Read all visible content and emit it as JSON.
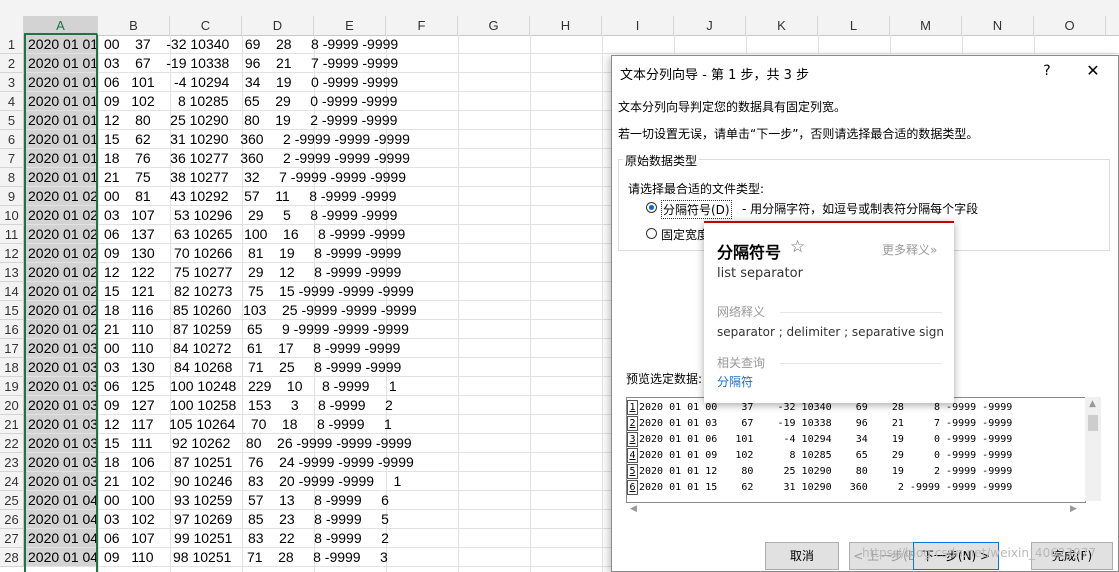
{
  "columns": [
    "A",
    "B",
    "C",
    "D",
    "E",
    "F",
    "G",
    "H",
    "I",
    "J",
    "K",
    "L",
    "M",
    "N",
    "O"
  ],
  "selected_column": "A",
  "rows": [
    {
      "n": "1",
      "a": "2020 01 01",
      "rest": "00    37    -32 10340    69    28     8 -9999 -9999"
    },
    {
      "n": "2",
      "a": "2020 01 01",
      "rest": "03    67    -19 10338    96    21     7 -9999 -9999"
    },
    {
      "n": "3",
      "a": "2020 01 01",
      "rest": "06   101     -4 10294    34    19     0 -9999 -9999"
    },
    {
      "n": "4",
      "a": "2020 01 01",
      "rest": "09   102      8 10285    65    29     0 -9999 -9999"
    },
    {
      "n": "5",
      "a": "2020 01 01",
      "rest": "12    80     25 10290    80    19     2 -9999 -9999"
    },
    {
      "n": "6",
      "a": "2020 01 01",
      "rest": "15    62     31 10290   360     2 -9999 -9999 -9999"
    },
    {
      "n": "7",
      "a": "2020 01 01",
      "rest": "18    76     36 10277   360     2 -9999 -9999 -9999"
    },
    {
      "n": "8",
      "a": "2020 01 01",
      "rest": "21    75     38 10277    32     7 -9999 -9999 -9999"
    },
    {
      "n": "9",
      "a": "2020 01 02",
      "rest": "00    81     43 10292    57    11     8 -9999 -9999"
    },
    {
      "n": "10",
      "a": "2020 01 02",
      "rest": "03   107     53 10296    29     5     8 -9999 -9999"
    },
    {
      "n": "11",
      "a": "2020 01 02",
      "rest": "06   137     63 10265   100    16     8 -9999 -9999"
    },
    {
      "n": "12",
      "a": "2020 01 02",
      "rest": "09   130     70 10266    81    19     8 -9999 -9999"
    },
    {
      "n": "13",
      "a": "2020 01 02",
      "rest": "12   122     75 10277    29    12     8 -9999 -9999"
    },
    {
      "n": "14",
      "a": "2020 01 02",
      "rest": "15   121     82 10273    75    15 -9999 -9999 -9999"
    },
    {
      "n": "15",
      "a": "2020 01 02",
      "rest": "18   116     85 10260   103    25 -9999 -9999 -9999"
    },
    {
      "n": "16",
      "a": "2020 01 02",
      "rest": "21   110     87 10259    65     9 -9999 -9999 -9999"
    },
    {
      "n": "17",
      "a": "2020 01 03",
      "rest": "00   110     84 10272    61    17     8 -9999 -9999"
    },
    {
      "n": "18",
      "a": "2020 01 03",
      "rest": "03   130     84 10268    71    25     8 -9999 -9999"
    },
    {
      "n": "19",
      "a": "2020 01 03",
      "rest": "06   125    100 10248   229    10     8 -9999     1"
    },
    {
      "n": "20",
      "a": "2020 01 03",
      "rest": "09   127    100 10258   153     3     8 -9999     2"
    },
    {
      "n": "21",
      "a": "2020 01 03",
      "rest": "12   117    105 10264    70    18     8 -9999     1"
    },
    {
      "n": "22",
      "a": "2020 01 03",
      "rest": "15   111     92 10262    80    26 -9999 -9999 -9999"
    },
    {
      "n": "23",
      "a": "2020 01 03",
      "rest": "18   106     87 10251    76    24 -9999 -9999 -9999"
    },
    {
      "n": "24",
      "a": "2020 01 03",
      "rest": "21   102     90 10246    83    20 -9999 -9999     1"
    },
    {
      "n": "25",
      "a": "2020 01 04",
      "rest": "00   100     93 10259    57    13     8 -9999     6"
    },
    {
      "n": "26",
      "a": "2020 01 04",
      "rest": "03   102     97 10269    85    23     8 -9999     5"
    },
    {
      "n": "27",
      "a": "2020 01 04",
      "rest": "06   107     99 10251    83    22     8 -9999     2"
    },
    {
      "n": "28",
      "a": "2020 01 04",
      "rest": "09   110     98 10251    71    28     8 -9999     3"
    }
  ],
  "dialog": {
    "title": "文本分列向导 - 第 1 步，共 3 步",
    "help": "?",
    "close": "✕",
    "desc1": "文本分列向导判定您的数据具有固定列宽。",
    "desc2": "若一切设置无误，请单击“下一步”，否则请选择最合适的数据类型。",
    "group_label": "原始数据类型",
    "prompt": "请选择最合适的文件类型:",
    "option1_label": "分隔符号(D)",
    "option1_desc": "- 用分隔字符，如逗号或制表符分隔每个字段",
    "option2_label": "固定宽度",
    "preview_label": "预览选定数据:",
    "preview_rows": [
      {
        "n": "1",
        "line": "2020 01 01 00    37    -32 10340    69    28     8 -9999 -9999"
      },
      {
        "n": "2",
        "line": "2020 01 01 03    67    -19 10338    96    21     7 -9999 -9999"
      },
      {
        "n": "3",
        "line": "2020 01 01 06   101     -4 10294    34    19     0 -9999 -9999"
      },
      {
        "n": "4",
        "line": "2020 01 01 09   102      8 10285    65    29     0 -9999 -9999"
      },
      {
        "n": "5",
        "line": "2020 01 01 12    80     25 10290    80    19     2 -9999 -9999"
      },
      {
        "n": "6",
        "line": "2020 01 01 15    62     31 10290   360     2 -9999 -9999 -9999"
      }
    ],
    "buttons": {
      "cancel": "取消",
      "prev": "< 上一步(B)",
      "next": "下一步(N) >",
      "finish": "完成(F)"
    },
    "watermark": "https://blog.csdn.net/weixin_40623977"
  },
  "tooltip": {
    "word": "分隔符号",
    "star": "☆",
    "more": "更多释义»",
    "translation": "list separator",
    "web_heading": "网络释义",
    "web_meanings": "separator ; delimiter ; separative sign",
    "related_heading": "相关查询",
    "related": "分隔符",
    "accent": "#c40000"
  }
}
